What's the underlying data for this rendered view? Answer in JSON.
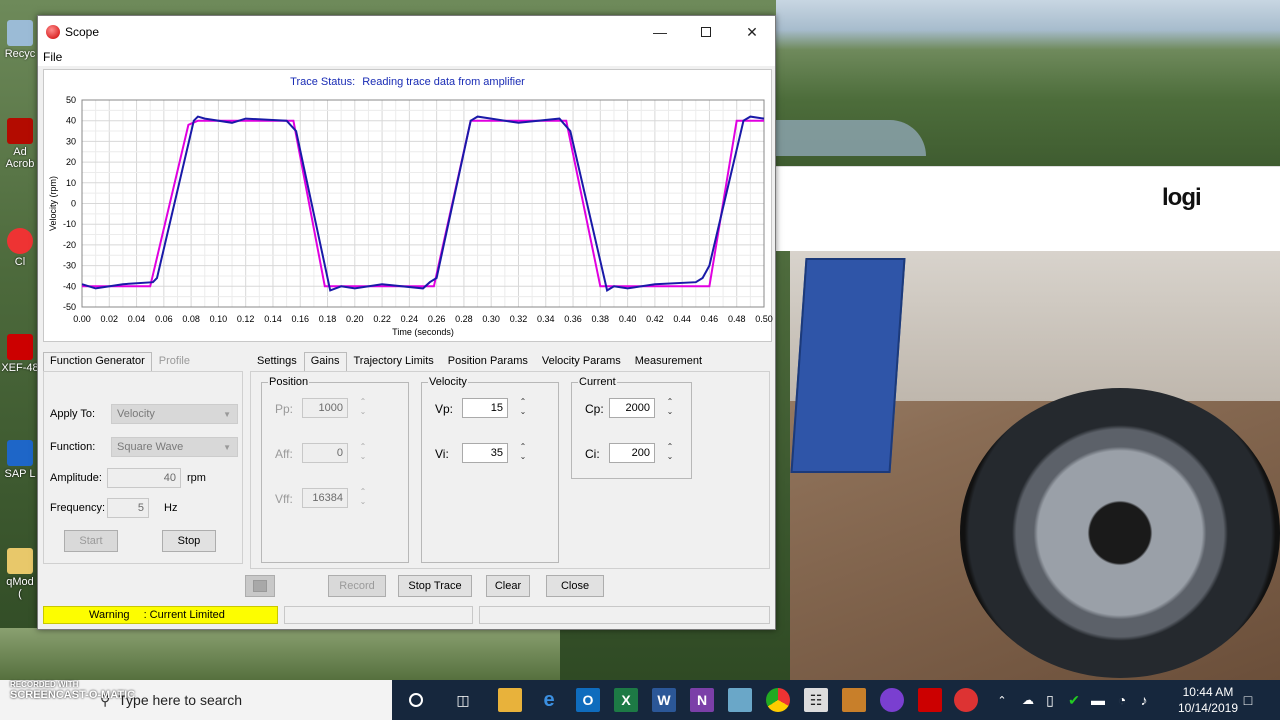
{
  "window": {
    "title": "Scope",
    "menu": [
      "File"
    ]
  },
  "trace": {
    "status_label": "Trace Status:",
    "status_text": "Reading trace data from amplifier"
  },
  "chart_data": {
    "type": "line",
    "title": "",
    "xlabel": "Time (seconds)",
    "ylabel": "Velocity (rpm)",
    "xlim": [
      0.0,
      0.5
    ],
    "ylim": [
      -50,
      50
    ],
    "x_ticks": [
      "0.00",
      "0.02",
      "0.04",
      "0.06",
      "0.08",
      "0.10",
      "0.12",
      "0.14",
      "0.16",
      "0.18",
      "0.20",
      "0.22",
      "0.24",
      "0.26",
      "0.28",
      "0.30",
      "0.32",
      "0.34",
      "0.36",
      "0.38",
      "0.40",
      "0.42",
      "0.44",
      "0.46",
      "0.48",
      "0.50"
    ],
    "y_ticks": [
      "50",
      "40",
      "30",
      "20",
      "10",
      "0",
      "-10",
      "-20",
      "-30",
      "-40",
      "-50"
    ],
    "grid": true,
    "series": [
      {
        "color": "#e000e0",
        "x": [
          0,
          0.05,
          0.078,
          0.085,
          0.1,
          0.12,
          0.13,
          0.155,
          0.178,
          0.19,
          0.2,
          0.22,
          0.25,
          0.258,
          0.285,
          0.3,
          0.31,
          0.33,
          0.35,
          0.355,
          0.38,
          0.392,
          0.41,
          0.43,
          0.445,
          0.46,
          0.48,
          0.5
        ],
        "y": [
          -40,
          -40,
          38,
          40,
          40,
          40,
          40,
          40,
          -40,
          -40,
          -40,
          -40,
          -40,
          -40,
          40,
          40,
          40,
          40,
          40,
          40,
          -40,
          -40,
          -40,
          -40,
          -40,
          -40,
          40,
          40
        ]
      },
      {
        "color": "#1a1aa8",
        "x": [
          0,
          0.01,
          0.03,
          0.052,
          0.055,
          0.082,
          0.085,
          0.09,
          0.11,
          0.12,
          0.15,
          0.157,
          0.182,
          0.19,
          0.2,
          0.22,
          0.25,
          0.255,
          0.26,
          0.285,
          0.29,
          0.3,
          0.32,
          0.35,
          0.358,
          0.385,
          0.39,
          0.4,
          0.42,
          0.45,
          0.455,
          0.46,
          0.485,
          0.49,
          0.5
        ],
        "y": [
          -39,
          -41,
          -39,
          -38,
          -36,
          40,
          42,
          41,
          39,
          41,
          40,
          35,
          -42,
          -40,
          -41,
          -39,
          -41,
          -38,
          -36,
          40,
          42,
          41,
          39,
          41,
          35,
          -42,
          -40,
          -41,
          -39,
          -38,
          -36,
          -30,
          40,
          42,
          41
        ]
      }
    ]
  },
  "tabs_left": [
    "Function Generator",
    "Profile"
  ],
  "function_generator": {
    "apply_to_label": "Apply To:",
    "apply_to_value": "Velocity",
    "function_label": "Function:",
    "function_value": "Square Wave",
    "amplitude_label": "Amplitude:",
    "amplitude_value": "40",
    "amplitude_unit": "rpm",
    "frequency_label": "Frequency:",
    "frequency_value": "5",
    "frequency_unit": "Hz",
    "start_label": "Start",
    "stop_label": "Stop"
  },
  "tabs_right": [
    "Settings",
    "Gains",
    "Trajectory Limits",
    "Position Params",
    "Velocity Params",
    "Measurement"
  ],
  "gains": {
    "position_title": "Position",
    "pp_label": "Pp:",
    "pp_value": "1000",
    "aff_label": "Aff:",
    "aff_value": "0",
    "vff_label": "Vff:",
    "vff_value": "16384",
    "velocity_title": "Velocity",
    "vp_label": "Vp:",
    "vp_value": "15",
    "vi_label": "Vi:",
    "vi_value": "35",
    "current_title": "Current",
    "cp_label": "Cp:",
    "cp_value": "2000",
    "ci_label": "Ci:",
    "ci_value": "200"
  },
  "bottom_buttons": {
    "record": "Record",
    "stop_trace": "Stop Trace",
    "clear": "Clear",
    "close": "Close"
  },
  "status": {
    "warning_label": "Warning",
    "warning_text": ": Current Limited"
  },
  "webcam": {
    "brand": "logi"
  },
  "taskbar": {
    "search_placeholder": "Type here to search",
    "time": "10:44 AM",
    "date": "10/14/2019",
    "recorded_with": "RECORDED WITH",
    "recorder": "SCREENCAST-O-MATIC"
  },
  "desktop_icons": [
    "Recyc",
    "Ad",
    "Acrob",
    "Cl",
    "XEF-48",
    "SAP L",
    "qMod",
    "("
  ]
}
